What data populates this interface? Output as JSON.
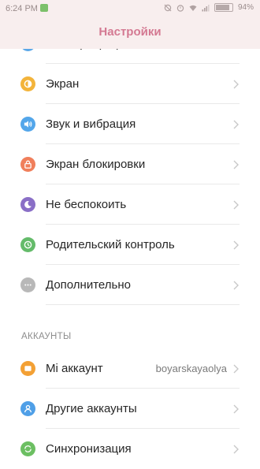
{
  "status_bar": {
    "time": "6:24 PM",
    "battery_pct": "94%",
    "battery_level": 0.94
  },
  "header": {
    "title": "Настройки"
  },
  "items": [
    {
      "label": "Размер шрифта",
      "icon": "font-size-icon",
      "color": "#5aa7e8"
    },
    {
      "label": "Экран",
      "icon": "display-icon",
      "color": "#f3b43b"
    },
    {
      "label": "Звук и вибрация",
      "icon": "speaker-icon",
      "color": "#53a6ea"
    },
    {
      "label": "Экран блокировки",
      "icon": "lock-icon",
      "color": "#f07f5b"
    },
    {
      "label": "Не беспокоить",
      "icon": "moon-icon",
      "color": "#8a6fc7"
    },
    {
      "label": "Родительский контроль",
      "icon": "parental-clock-icon",
      "color": "#64bb6a"
    },
    {
      "label": "Дополнительно",
      "icon": "more-dots-icon",
      "color": "#b8b8b8"
    }
  ],
  "accounts_section": {
    "title": "АККАУНТЫ",
    "items": [
      {
        "label": "Mi аккаунт",
        "value": "boyarskayaolya",
        "icon": "mi-account-icon",
        "color": "#f3a034"
      },
      {
        "label": "Другие аккаунты",
        "icon": "person-icon",
        "color": "#4f9fe7"
      },
      {
        "label": "Синхронизация",
        "icon": "sync-icon",
        "color": "#6cbf62"
      }
    ]
  }
}
